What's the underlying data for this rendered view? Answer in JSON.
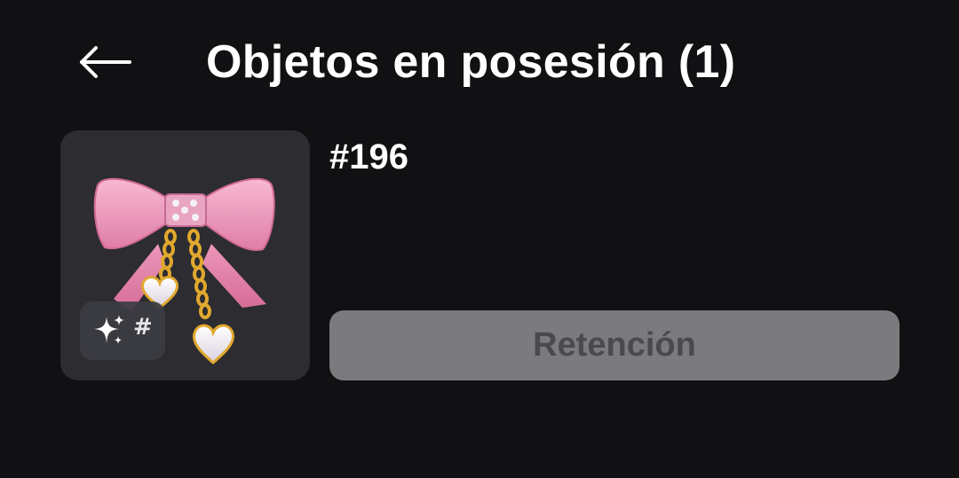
{
  "header": {
    "title": "Objetos en posesión (1)",
    "back_icon": "arrow-left-icon"
  },
  "item": {
    "serial": "#196",
    "badge_icon": "sparkles-icon",
    "badge_text": "#",
    "thumbnail_icon": "pink-bow-with-heart-chains-icon"
  },
  "action": {
    "button_label": "Retención",
    "state": "disabled"
  },
  "colors": {
    "background": "#111113",
    "card": "#2c2c31",
    "button_disabled_bg": "#7b7b7e",
    "button_disabled_text": "#4a4a4d",
    "bow_pink": "#f2a3c4",
    "chain_gold": "#e0a82e"
  }
}
